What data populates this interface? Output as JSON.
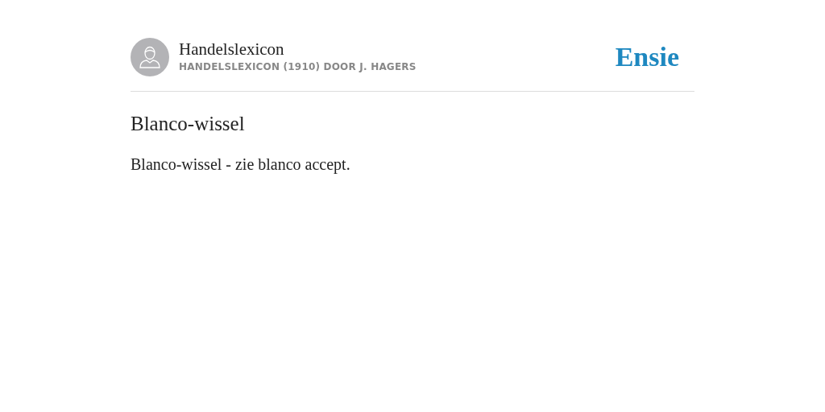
{
  "header": {
    "title": "Handelslexicon",
    "subtitle": "HANDELSLEXICON (1910) DOOR J. HAGERS",
    "logo": "Ensie"
  },
  "entry": {
    "heading": "Blanco-wissel",
    "body": "Blanco-wissel - zie blanco accept."
  }
}
